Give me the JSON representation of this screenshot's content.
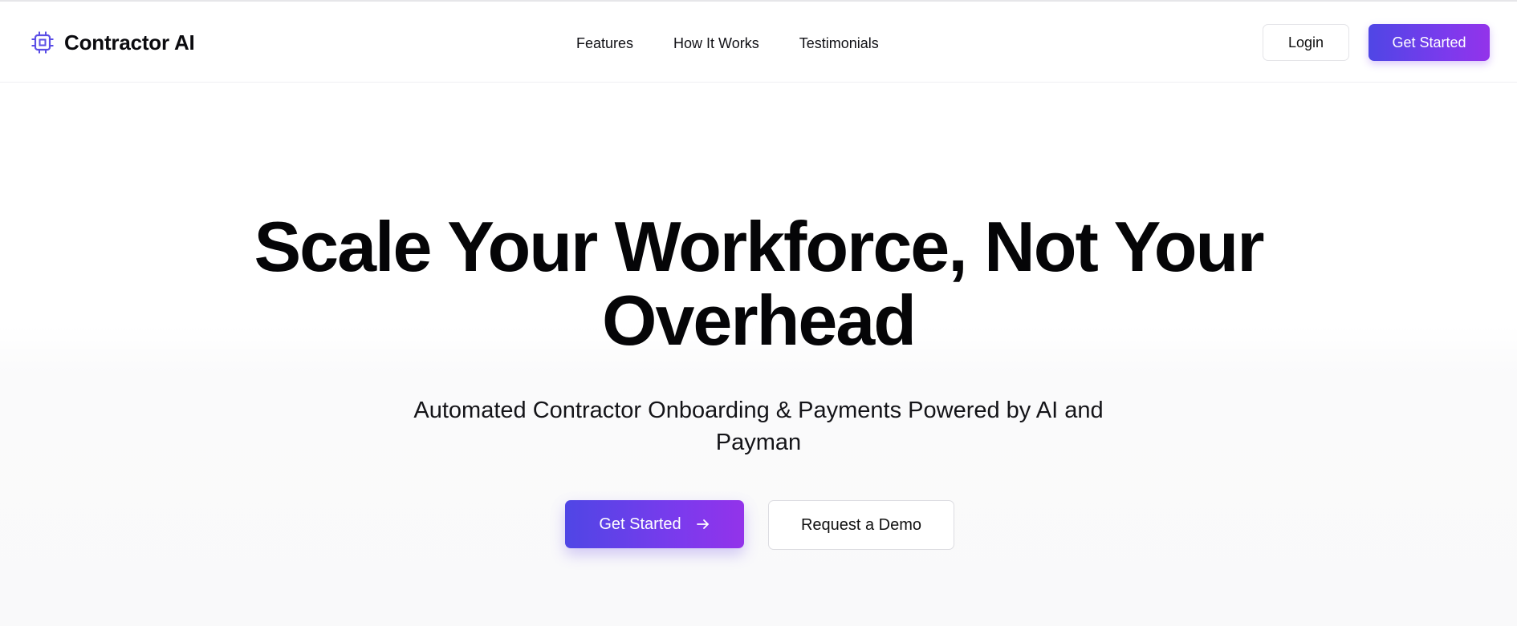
{
  "header": {
    "brand_name": "Contractor AI",
    "logo_icon": "cpu-chip-icon",
    "nav": [
      {
        "label": "Features"
      },
      {
        "label": "How It Works"
      },
      {
        "label": "Testimonials"
      }
    ],
    "login_label": "Login",
    "get_started_label": "Get Started"
  },
  "hero": {
    "title_line1": "Scale Your Workforce, Not Your",
    "title_line2": "Overhead",
    "subtitle": "Automated Contractor Onboarding & Payments Powered by AI and Payman",
    "primary_cta_label": "Get Started",
    "primary_cta_icon": "arrow-right-icon",
    "secondary_cta_label": "Request a Demo"
  },
  "colors": {
    "accent_start": "#4f46e5",
    "accent_end": "#9333ea",
    "text": "#0a0a0a",
    "background": "#ffffff"
  }
}
